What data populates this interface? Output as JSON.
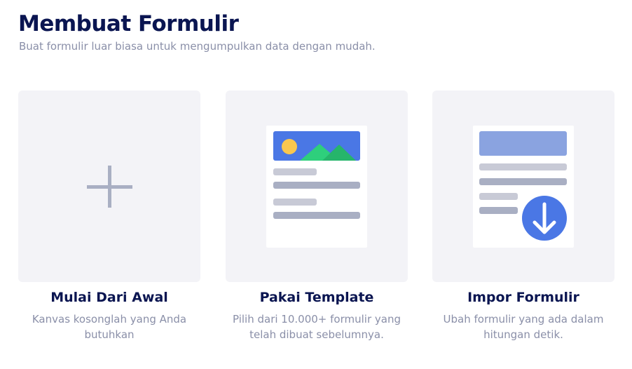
{
  "header": {
    "title": "Membuat Formulir",
    "subtitle": "Buat formulir luar biasa untuk mengumpulkan data dengan mudah."
  },
  "cards": [
    {
      "title": "Mulai Dari Awal",
      "description": "Kanvas kosonglah yang Anda butuhkan",
      "icon": "plus-icon"
    },
    {
      "title": "Pakai Template",
      "description": "Pilih dari 10.000+ formulir yang telah dibuat sebelumnya.",
      "icon": "template-form-icon"
    },
    {
      "title": "Impor Formulir",
      "description": "Ubah formulir yang ada dalam hitungan detik.",
      "icon": "import-form-icon"
    }
  ],
  "colors": {
    "title": "#0a1551",
    "muted_text": "#8a8fa8",
    "card_bg": "#f3f3f7",
    "accent_blue": "#4a77e5",
    "image_green": "#2ecf7c",
    "sun_yellow": "#f9c74f"
  }
}
